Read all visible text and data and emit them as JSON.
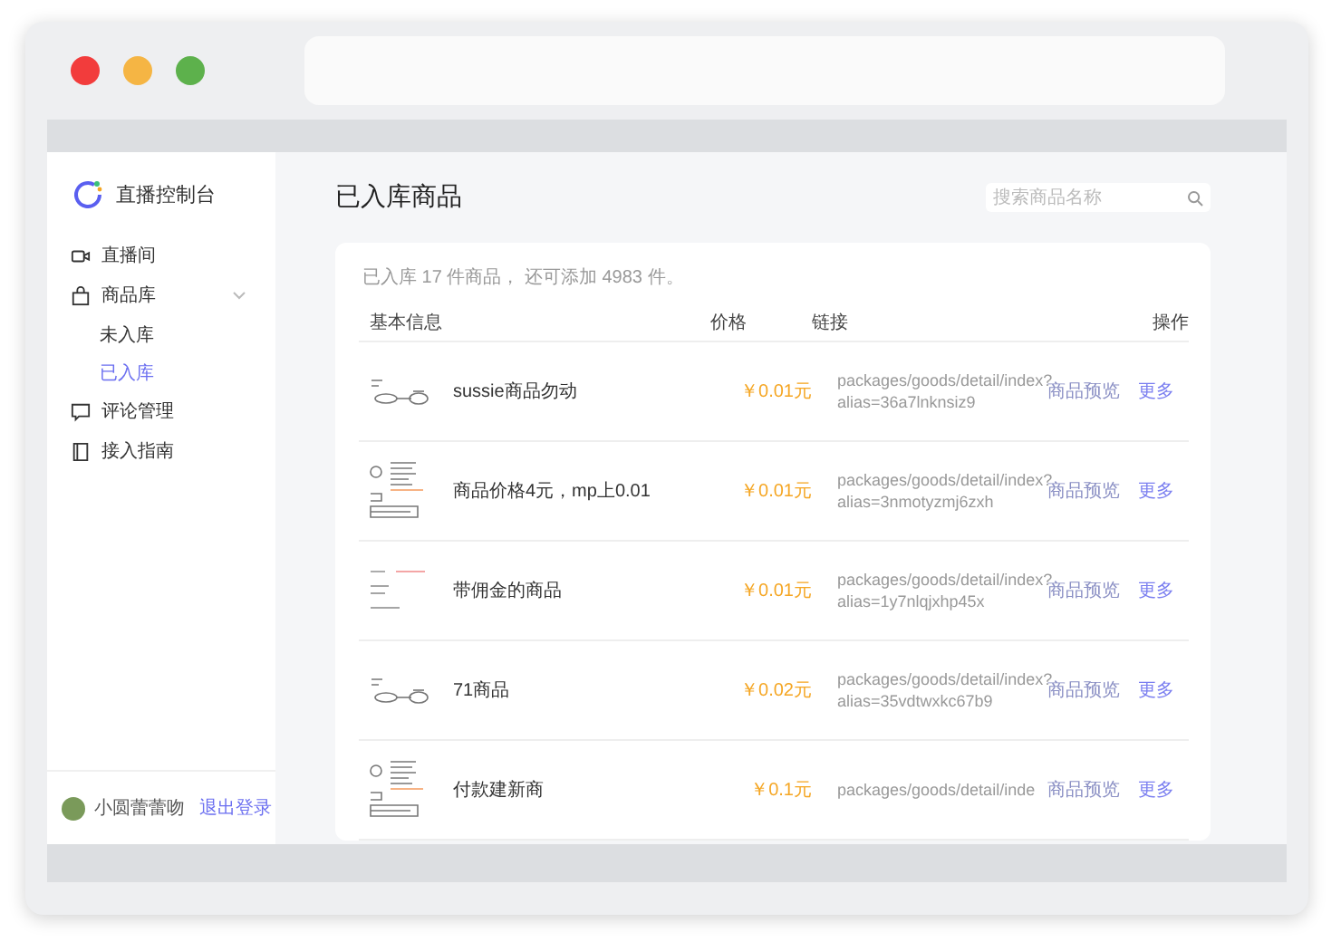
{
  "sidebar": {
    "app_title": "直播控制台",
    "items": [
      {
        "label": "直播间",
        "kind": "video",
        "selected": false
      },
      {
        "label": "商品库",
        "kind": "bag",
        "selected": false,
        "expanded": true,
        "children": [
          {
            "label": "未入库",
            "selected": false
          },
          {
            "label": "已入库",
            "selected": true
          }
        ]
      },
      {
        "label": "评论管理",
        "kind": "comment",
        "selected": false
      },
      {
        "label": "接入指南",
        "kind": "book",
        "selected": false
      }
    ],
    "user": {
      "name": "小圆蕾蕾吻",
      "logout": "退出登录"
    }
  },
  "page": {
    "title": "已入库商品",
    "search": {
      "placeholder": "搜索商品名称"
    },
    "summary": "已入库 17 件商品， 还可添加 4983 件。"
  },
  "table": {
    "columns": [
      "基本信息",
      "价格",
      "链接",
      "操作"
    ],
    "rows": [
      {
        "name": "sussie商品勿动",
        "price": "￥0.01元",
        "link": "packages/goods/detail/index?alias=36a7lnknsiz9",
        "actions": [
          "商品预览",
          "更多"
        ]
      },
      {
        "name": "商品价格4元，mp上0.01",
        "price": "￥0.01元",
        "link": "packages/goods/detail/index?alias=3nmotyzmj6zxh",
        "actions": [
          "商品预览",
          "更多"
        ]
      },
      {
        "name": "带佣金的商品",
        "price": "￥0.01元",
        "link": "packages/goods/detail/index?alias=1y7nlqjxhp45x",
        "actions": [
          "商品预览",
          "更多"
        ]
      },
      {
        "name": "71商品",
        "price": "￥0.02元",
        "link": "packages/goods/detail/index?alias=35vdtwxkc67b9",
        "actions": [
          "商品预览",
          "更多"
        ]
      },
      {
        "name": "付款建新商",
        "price": "￥0.1元",
        "link": "packages/goods/detail/inde",
        "actions": [
          "商品预览",
          "更多"
        ]
      }
    ]
  }
}
